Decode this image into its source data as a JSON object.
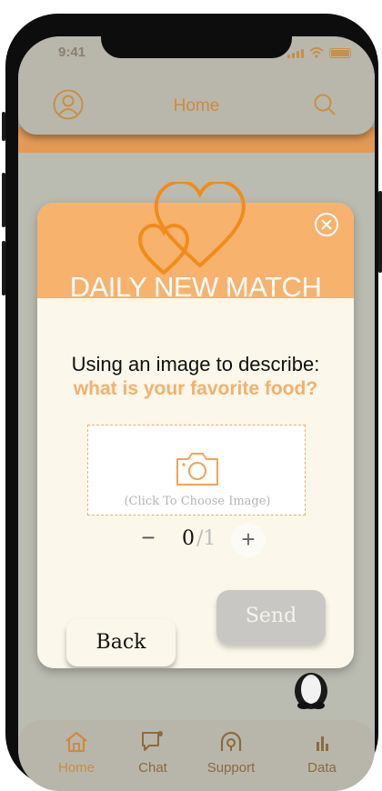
{
  "status_bar": {
    "time": "9:41"
  },
  "header": {
    "title": "Home",
    "profile_icon": "profile-icon",
    "search_icon": "search-icon"
  },
  "dialog": {
    "title": "DAILY NEW MATCH",
    "prompt_line1": "Using an image to describe:",
    "prompt_line2": "what is your favorite food?",
    "image_placeholder": "(Click To Choose Image)",
    "counter": {
      "minus": "−",
      "current": "0",
      "max_label": "/1",
      "plus": "+"
    },
    "back_label": "Back",
    "send_label": "Send"
  },
  "bottom_nav": {
    "items": [
      {
        "label": "Home",
        "icon": "home-icon",
        "active": true
      },
      {
        "label": "Chat",
        "icon": "chat-icon",
        "active": false
      },
      {
        "label": "Support",
        "icon": "support-icon",
        "active": false
      },
      {
        "label": "Data",
        "icon": "data-icon",
        "active": false
      }
    ]
  },
  "colors": {
    "accent": "#f7b26d",
    "active_nav": "#d08a3e",
    "nav_inactive": "#8c6a3e",
    "background": "#babbb1"
  }
}
